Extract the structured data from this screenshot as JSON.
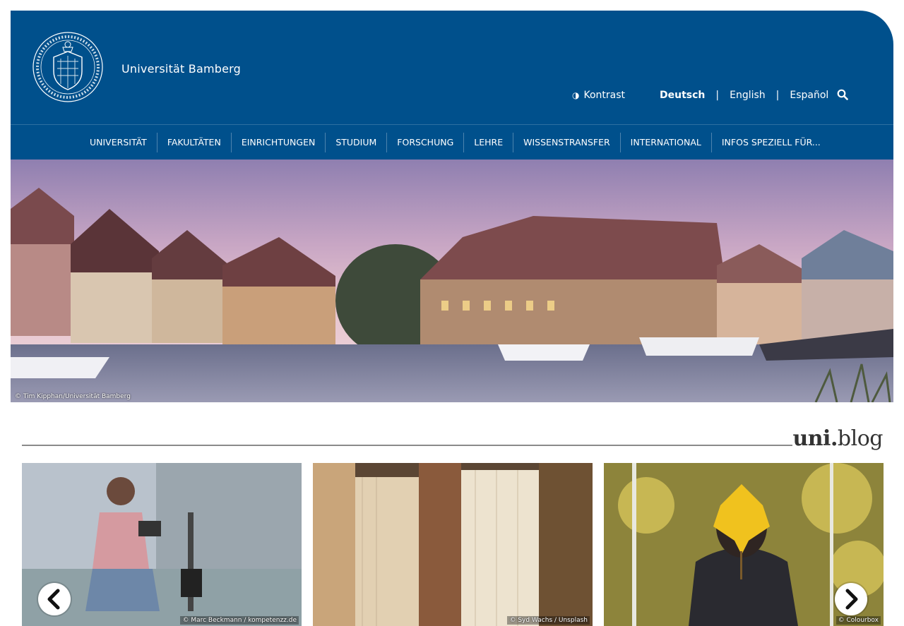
{
  "header": {
    "university_name": "Universität Bamberg",
    "contrast_label": "Kontrast",
    "languages": [
      {
        "label": "Deutsch",
        "active": true
      },
      {
        "label": "English",
        "active": false
      },
      {
        "label": "Español",
        "active": false
      }
    ],
    "separator": "|"
  },
  "nav": {
    "items": [
      "UNIVERSITÄT",
      "FAKULTÄTEN",
      "EINRICHTUNGEN",
      "STUDIUM",
      "FORSCHUNG",
      "LEHRE",
      "WISSENSTRANSFER",
      "INTERNATIONAL",
      "INFOS SPEZIELL FÜR..."
    ]
  },
  "hero": {
    "credit": "© Tim Kipphan/Universität Bamberg"
  },
  "blog": {
    "logo_uni": "uni",
    "logo_dot": ".",
    "logo_blog": "blog",
    "cards": [
      {
        "credit": "© Marc Beckmann / kompetenzz.de"
      },
      {
        "credit": "© Syd Wachs / Unsplash"
      },
      {
        "credit": "© Colourbox"
      }
    ]
  },
  "colors": {
    "brand_blue": "#00508c"
  },
  "icons": [
    "contrast-icon",
    "search-icon",
    "university-seal",
    "chevron-left-icon",
    "chevron-right-icon"
  ]
}
